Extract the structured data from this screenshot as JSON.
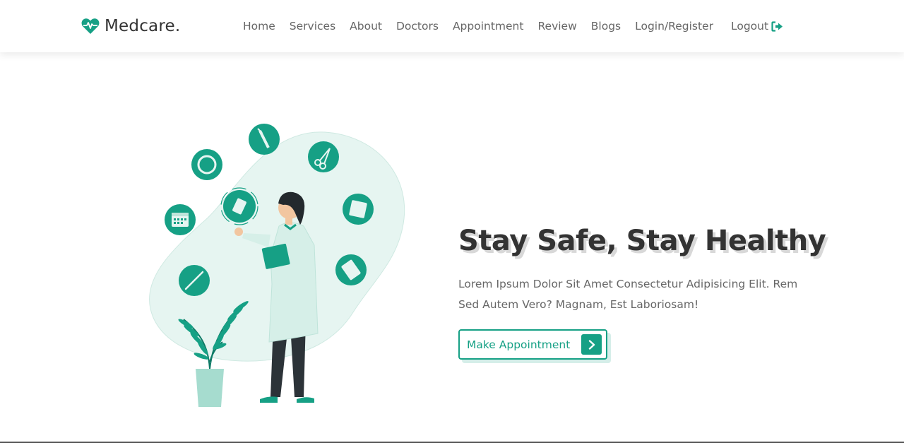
{
  "header": {
    "brand": "Medcare.",
    "nav": [
      {
        "label": "Home"
      },
      {
        "label": "Services"
      },
      {
        "label": "About"
      },
      {
        "label": "Doctors"
      },
      {
        "label": "Appointment"
      },
      {
        "label": "Review"
      },
      {
        "label": "Blogs"
      },
      {
        "label": "Login/Register"
      }
    ],
    "logout_label": "Logout"
  },
  "hero": {
    "title": "Stay Safe, Stay Healthy",
    "paragraph": "Lorem Ipsum Dolor Sit Amet Consectetur Adipisicing Elit. Rem Sed Autem Vero? Magnam, Est Laboriosam!",
    "cta_label": "Make Appointment"
  },
  "icons": {
    "brand_icon": "heart-pulse-icon",
    "logout_icon": "sign-out-icon",
    "cta_icon": "chevron-right-icon"
  },
  "colors": {
    "accent": "#16a085",
    "accent_light": "#e6f5f1",
    "heading": "#333333",
    "text": "#666666"
  }
}
